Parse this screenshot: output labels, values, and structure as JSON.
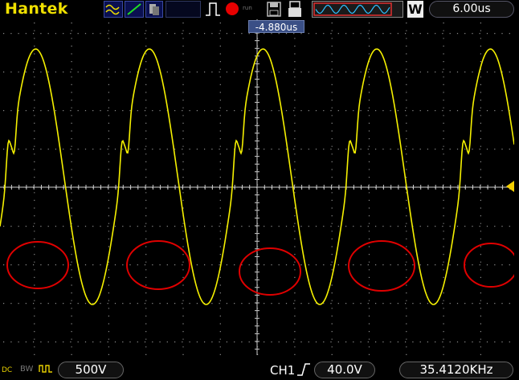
{
  "toolbar": {
    "brand": "Hantek",
    "run_small_label": "run",
    "w_button": "W",
    "timebase": "6.00us"
  },
  "trigger_position": "-4.880us",
  "status": {
    "coupling": "DC",
    "bw_label": "BW",
    "channel_scale": "500V",
    "trigger_source": "CH1",
    "trigger_level": "40.0V",
    "frequency": "35.4120KHz"
  },
  "colors": {
    "trace": "#f5f000",
    "annotation": "#e00000",
    "grid": "#8a8a8a",
    "axis": "#cccccc",
    "trigger_marker": "#f5d000"
  },
  "icons": [
    "mode-icon",
    "line-icon",
    "persist-icon",
    "trigger-pulse-icon",
    "run-indicator",
    "save-icon",
    "usb-icon",
    "waveform-window",
    "rising-edge-icon",
    "ground-icon"
  ]
}
